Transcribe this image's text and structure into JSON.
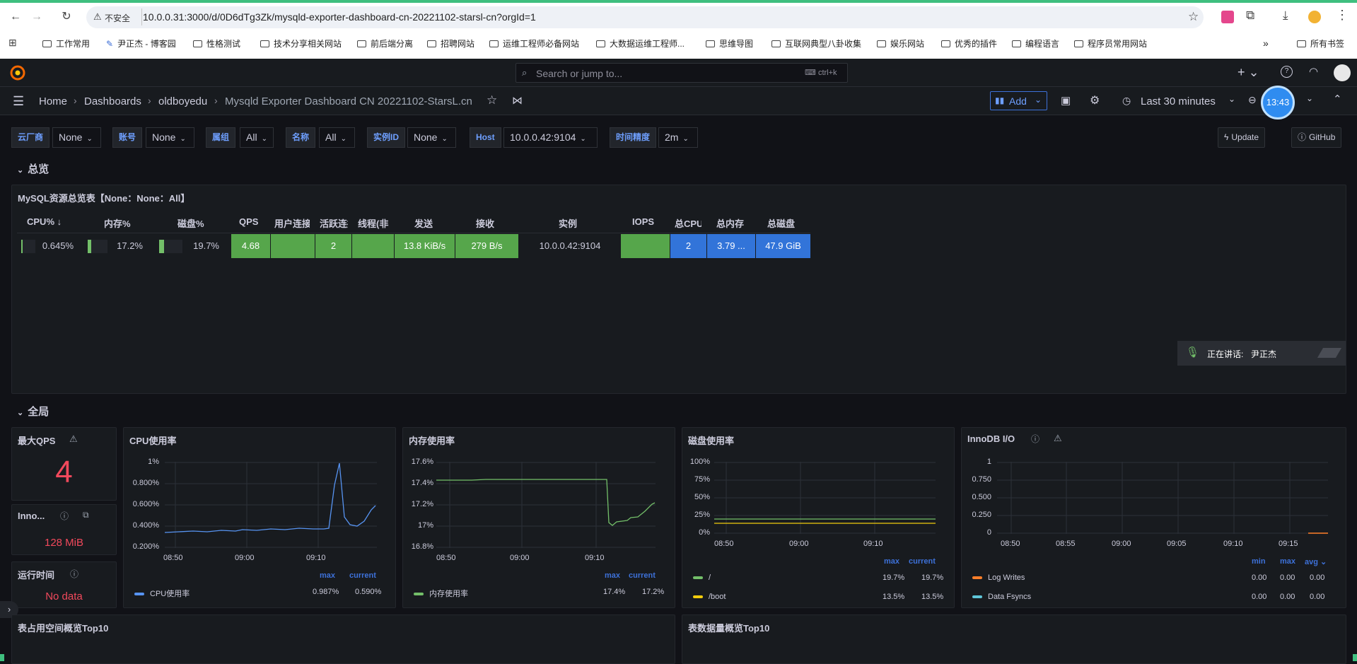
{
  "browser": {
    "insecure_label": "不安全",
    "url": "10.0.0.31:3000/d/0D6dTg3Zk/mysqld-exporter-dashboard-cn-20221102-starsl-cn?orgId=1",
    "bookmarks": [
      "工作常用",
      "尹正杰 - 博客园",
      "性格测试",
      "技术分享相关网站",
      "前后端分离",
      "招聘网站",
      "运维工程师必备网站",
      "大数据运维工程师...",
      "思维导图",
      "互联网典型八卦收集",
      "娱乐网站",
      "优秀的插件",
      "编程语言",
      "程序员常用网站"
    ],
    "bookmarks_more": "»",
    "all_bookmarks": "所有书签"
  },
  "grafana": {
    "search_placeholder": "Search or jump to...",
    "search_shortcut": "ctrl+k",
    "breadcrumb": [
      "Home",
      "Dashboards",
      "oldboyedu",
      "Mysqld Exporter Dashboard CN 20221102-StarsL.cn"
    ],
    "add_label": "Add",
    "time_range": "Last 30 minutes",
    "clock": "13:43",
    "update_label": "Update",
    "github_label": "GitHub"
  },
  "variables": [
    {
      "label": "云厂商",
      "value": "None"
    },
    {
      "label": "账号",
      "value": "None"
    },
    {
      "label": "属组",
      "value": "All"
    },
    {
      "label": "名称",
      "value": "All"
    },
    {
      "label": "实例ID",
      "value": "None"
    },
    {
      "label": "Host",
      "value": "10.0.0.42:9104"
    },
    {
      "label": "时间精度",
      "value": "2m"
    }
  ],
  "rows": {
    "overview": "总览",
    "global": "全局"
  },
  "overview_table": {
    "title": "MySQL资源总览表【None：None：All】",
    "headers": [
      "CPU% ↓",
      "内存%",
      "磁盘%",
      "QPS",
      "用户连接",
      "活跃连接",
      "线程(非",
      "发送",
      "接收",
      "实例",
      "IOPS",
      "总CPU",
      "总内存",
      "总磁盘"
    ],
    "row": {
      "cpu": "0.645%",
      "cpu_fraction": 0.00645,
      "mem": "17.2%",
      "mem_fraction": 0.172,
      "disk": "19.7%",
      "disk_fraction": 0.197,
      "qps": "4.68",
      "user_conn": "",
      "active": "2",
      "threads": "",
      "send": "13.8 KiB/s",
      "recv": "279 B/s",
      "instance": "10.0.0.42:9104",
      "iops": "",
      "total_cpu": "2",
      "total_mem": "3.79 ...",
      "total_disk": "47.9 GiB"
    }
  },
  "speaking": {
    "label": "正在讲话:",
    "name": "尹正杰"
  },
  "stats": {
    "max_qps": {
      "title": "最大QPS",
      "value": "4"
    },
    "innodb": {
      "title": "Inno...",
      "value": "128 MiB"
    },
    "uptime": {
      "title": "运行时间",
      "value": "No data"
    }
  },
  "charts": {
    "cpu": {
      "title": "CPU使用率",
      "yticks": [
        "1%",
        "0.800%",
        "0.600%",
        "0.400%",
        "0.200%"
      ],
      "xticks": [
        "08:50",
        "09:00",
        "09:10"
      ],
      "legend_headers": [
        "max",
        "current"
      ],
      "series": [
        {
          "name": "CPU使用率",
          "max": "0.987%",
          "current": "0.590%"
        }
      ]
    },
    "mem": {
      "title": "内存使用率",
      "yticks": [
        "17.6%",
        "17.4%",
        "17.2%",
        "17%",
        "16.8%"
      ],
      "xticks": [
        "08:50",
        "09:00",
        "09:10"
      ],
      "legend_headers": [
        "max",
        "current"
      ],
      "series": [
        {
          "name": "内存使用率",
          "max": "17.4%",
          "current": "17.2%"
        }
      ]
    },
    "disk": {
      "title": "磁盘使用率",
      "yticks": [
        "100%",
        "75%",
        "50%",
        "25%",
        "0%"
      ],
      "xticks": [
        "08:50",
        "09:00",
        "09:10"
      ],
      "legend_headers": [
        "max",
        "current"
      ],
      "series": [
        {
          "name": "/",
          "max": "19.7%",
          "current": "19.7%"
        },
        {
          "name": "/boot",
          "max": "13.5%",
          "current": "13.5%"
        }
      ]
    },
    "innodb_io": {
      "title": "InnoDB I/O",
      "yticks": [
        "1",
        "0.750",
        "0.500",
        "0.250",
        "0"
      ],
      "xticks": [
        "08:50",
        "08:55",
        "09:00",
        "09:05",
        "09:10",
        "09:15"
      ],
      "legend_headers": [
        "min",
        "max",
        "avg"
      ],
      "series": [
        {
          "name": "Log Writes",
          "min": "0.00",
          "max": "0.00",
          "avg": "0.00"
        },
        {
          "name": "Data Fsyncs",
          "min": "0.00",
          "max": "0.00",
          "avg": "0.00"
        }
      ]
    }
  },
  "bottom_panels": [
    "表占用空间概览Top10",
    "表数据量概览Top10"
  ],
  "colors": {
    "green": "#56a64b",
    "blue": "#3274d9",
    "cpu_line": "#5794f2",
    "mem_line": "#73bf69",
    "disk_root": "#73bf69",
    "disk_boot": "#f2cc0c",
    "log_writes": "#ff7f2a",
    "data_fsyncs": "#5fc6d9",
    "red": "#f2495c"
  }
}
